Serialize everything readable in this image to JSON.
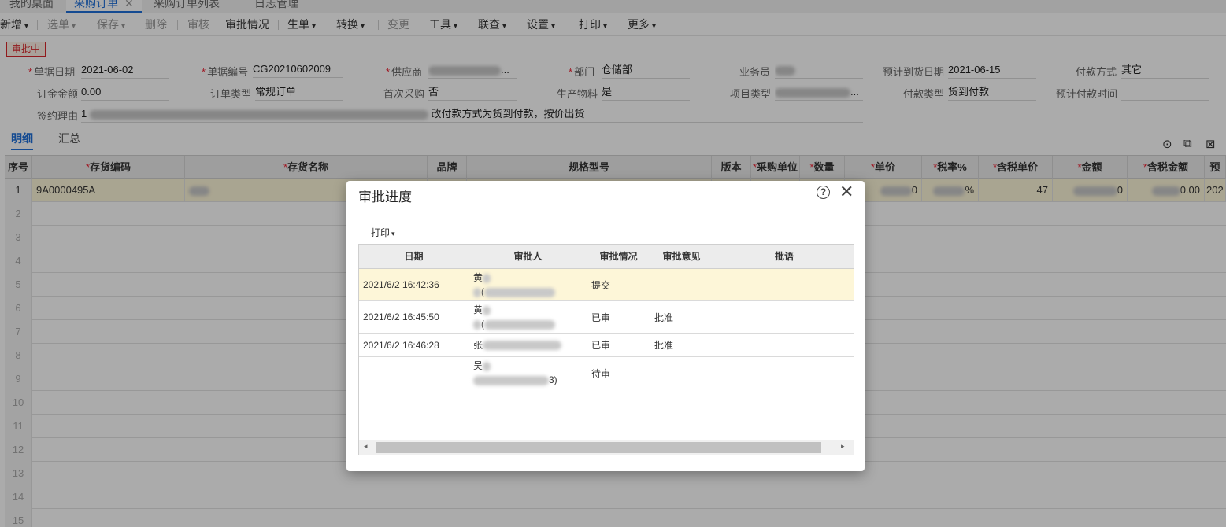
{
  "tabs": {
    "desktop": "我的桌面",
    "purchase_order": "采购订单",
    "close": "✕",
    "order_list": "采购订单列表",
    "log": "日志管理"
  },
  "toolbar": {
    "new": "新增",
    "select": "选单",
    "save": "保存",
    "delete": "删除",
    "audit": "审核",
    "approval_status": "审批情况",
    "generate": "生单",
    "convert": "转换",
    "change": "变更",
    "tools": "工具",
    "query": "联查",
    "settings": "设置",
    "print": "打印",
    "more": "更多",
    "caret": "▾"
  },
  "status_badge": "审批中",
  "form": {
    "doc_date_label": "单据日期",
    "doc_date": "2021-06-02",
    "doc_no_label": "单据编号",
    "doc_no": "CG20210602009",
    "supplier_label": "供应商",
    "supplier_tail": "...",
    "dept_label": "部门",
    "dept": "仓储部",
    "salesman_label": "业务员",
    "arrival_label": "预计到货日期",
    "arrival": "2021-06-15",
    "paymethod_label": "付款方式",
    "paymethod": "其它",
    "deposit_label": "订金金额",
    "deposit": "0.00",
    "ordertype_label": "订单类型",
    "ordertype": "常规订单",
    "firstbuy_label": "首次采购",
    "firstbuy": "否",
    "prodmat_label": "生产物料",
    "prodmat": "是",
    "projtype_label": "项目类型",
    "projtype_tail": "...",
    "paytype_label": "付款类型",
    "paytype": "货到付款",
    "paytime_label": "预计付款时间",
    "reason_label": "签约理由",
    "reason_start": "1",
    "reason_mid": "改付款方式为货到付款，按价出货",
    "required_mark": "*"
  },
  "detail_tabs": {
    "detail": "明细",
    "summary": "汇总"
  },
  "icons": {
    "location": "⊙",
    "copy": "⧉",
    "export": "⊠"
  },
  "grid": {
    "headers": [
      "序号",
      "存货编码",
      "存货名称",
      "品牌",
      "规格型号",
      "版本",
      "采购单位",
      "数量",
      "单价",
      "税率%",
      "含税单价",
      "金额",
      "含税金额",
      "预"
    ],
    "row1": {
      "num": "1",
      "code": "9A0000495A",
      "unit_price_tail": "0",
      "tax_tail": "%",
      "tax_price": "47",
      "amount_tail": "0",
      "tax_amount_tail": "0.00",
      "date_head": "202"
    },
    "row_numbers": [
      "2",
      "3",
      "4",
      "5",
      "6",
      "7",
      "8",
      "9",
      "10",
      "11",
      "12",
      "13",
      "14",
      "15"
    ]
  },
  "modal": {
    "title": "审批进度",
    "help": "?",
    "close": "✕",
    "print": "打印",
    "caret": "▾",
    "columns": [
      "日期",
      "审批人",
      "审批情况",
      "审批意见",
      "批语"
    ],
    "rows": [
      {
        "date": "2021/6/2 16:42:36",
        "approver_top": "黄",
        "approver_bottom": "(",
        "status": "提交",
        "opinion": ""
      },
      {
        "date": "2021/6/2 16:45:50",
        "approver_top": "黄",
        "approver_bottom": "(",
        "status": "已审",
        "opinion": "批准"
      },
      {
        "date": "2021/6/2 16:46:28",
        "approver_top": "张",
        "approver_bottom": "",
        "status": "已审",
        "opinion": "批准"
      },
      {
        "date": "",
        "approver_top": "吴",
        "approver_bottom": "3)",
        "status": "待审",
        "opinion": ""
      }
    ],
    "scroll_left": "◂",
    "scroll_right": "▸"
  },
  "colors": {
    "accent": "#1e6fd9",
    "status_red": "#d9262c",
    "selected_row": "#fdf6d8",
    "required": "#ee2233"
  }
}
